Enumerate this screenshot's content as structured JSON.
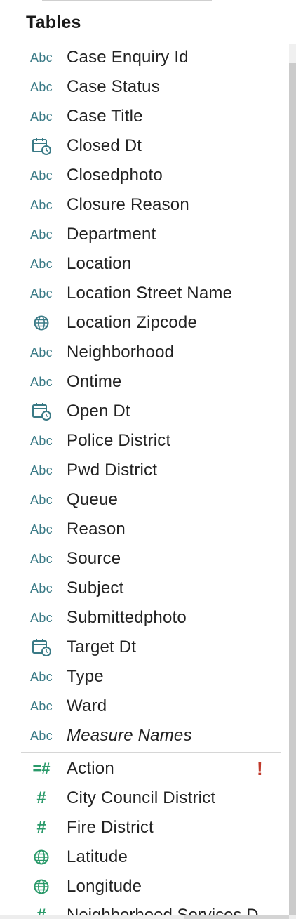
{
  "panel": {
    "title": "Tables"
  },
  "dimensions": [
    {
      "label": "Case Enquiry Id",
      "icon": "abc-string-icon",
      "icon_text": "Abc"
    },
    {
      "label": "Case Status",
      "icon": "abc-string-icon",
      "icon_text": "Abc"
    },
    {
      "label": "Case Title",
      "icon": "abc-string-icon",
      "icon_text": "Abc"
    },
    {
      "label": "Closed Dt",
      "icon": "calendar-datetime-icon",
      "icon_text": ""
    },
    {
      "label": "Closedphoto",
      "icon": "abc-string-icon",
      "icon_text": "Abc"
    },
    {
      "label": "Closure Reason",
      "icon": "abc-string-icon",
      "icon_text": "Abc"
    },
    {
      "label": "Department",
      "icon": "abc-string-icon",
      "icon_text": "Abc"
    },
    {
      "label": "Location",
      "icon": "abc-string-icon",
      "icon_text": "Abc"
    },
    {
      "label": "Location Street Name",
      "icon": "abc-string-icon",
      "icon_text": "Abc"
    },
    {
      "label": "Location Zipcode",
      "icon": "globe-icon",
      "icon_text": ""
    },
    {
      "label": "Neighborhood",
      "icon": "abc-string-icon",
      "icon_text": "Abc"
    },
    {
      "label": "Ontime",
      "icon": "abc-string-icon",
      "icon_text": "Abc"
    },
    {
      "label": "Open Dt",
      "icon": "calendar-datetime-icon",
      "icon_text": ""
    },
    {
      "label": "Police District",
      "icon": "abc-string-icon",
      "icon_text": "Abc"
    },
    {
      "label": "Pwd District",
      "icon": "abc-string-icon",
      "icon_text": "Abc"
    },
    {
      "label": "Queue",
      "icon": "abc-string-icon",
      "icon_text": "Abc"
    },
    {
      "label": "Reason",
      "icon": "abc-string-icon",
      "icon_text": "Abc"
    },
    {
      "label": "Source",
      "icon": "abc-string-icon",
      "icon_text": "Abc"
    },
    {
      "label": "Subject",
      "icon": "abc-string-icon",
      "icon_text": "Abc"
    },
    {
      "label": "Submittedphoto",
      "icon": "abc-string-icon",
      "icon_text": "Abc"
    },
    {
      "label": "Target Dt",
      "icon": "calendar-datetime-icon",
      "icon_text": ""
    },
    {
      "label": "Type",
      "icon": "abc-string-icon",
      "icon_text": "Abc"
    },
    {
      "label": "Ward",
      "icon": "abc-string-icon",
      "icon_text": "Abc"
    },
    {
      "label": "Measure Names",
      "icon": "abc-string-icon",
      "icon_text": "Abc",
      "italic": true
    }
  ],
  "measures": [
    {
      "label": "Action",
      "icon": "calculated-number-icon",
      "icon_text": "=#",
      "warning": "!"
    },
    {
      "label": "City Council District",
      "icon": "number-icon",
      "icon_text": "#"
    },
    {
      "label": "Fire District",
      "icon": "number-icon",
      "icon_text": "#"
    },
    {
      "label": "Latitude",
      "icon": "globe-icon",
      "icon_text": ""
    },
    {
      "label": "Longitude",
      "icon": "globe-icon",
      "icon_text": ""
    }
  ],
  "partial_item": {
    "label": "Neighborhood Services D",
    "icon": "number-icon",
    "icon_text": "#"
  },
  "colors": {
    "dimension_icon": "#3a7a86",
    "measure_icon": "#2a9a6a",
    "warning": "#c0392b",
    "text": "#222222"
  }
}
